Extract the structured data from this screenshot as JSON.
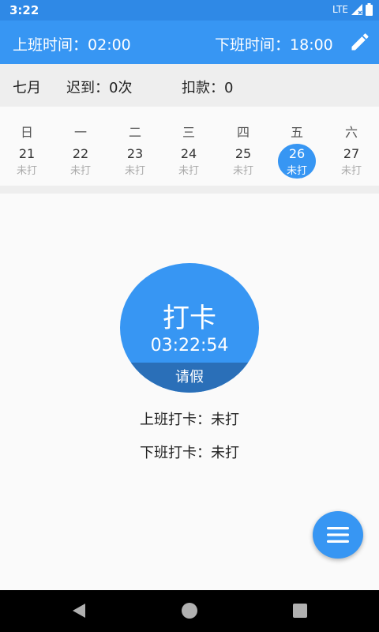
{
  "status_bar": {
    "time": "3:22",
    "network": "LTE"
  },
  "app_bar": {
    "start_label": "上班时间：",
    "start_time": "02:00",
    "end_label": "下班时间：",
    "end_time": "18:00",
    "edit_icon": "pencil-icon"
  },
  "summary": {
    "month": "七月",
    "late_label": "迟到：",
    "late_value": "0次",
    "deduct_label": "扣款：",
    "deduct_value": "0"
  },
  "week": {
    "days": [
      {
        "name": "日",
        "date": "21",
        "status": "未打",
        "selected": false
      },
      {
        "name": "一",
        "date": "22",
        "status": "未打",
        "selected": false
      },
      {
        "name": "二",
        "date": "23",
        "status": "未打",
        "selected": false
      },
      {
        "name": "三",
        "date": "24",
        "status": "未打",
        "selected": false
      },
      {
        "name": "四",
        "date": "25",
        "status": "未打",
        "selected": false
      },
      {
        "name": "五",
        "date": "26",
        "status": "未打",
        "selected": true
      },
      {
        "name": "六",
        "date": "27",
        "status": "未打",
        "selected": false
      }
    ]
  },
  "punch": {
    "label": "打卡",
    "time": "03:22:54",
    "leave_label": "请假"
  },
  "records": {
    "clock_in_label": "上班打卡：",
    "clock_in_value": "未打",
    "clock_out_label": "下班打卡：",
    "clock_out_value": "未打"
  },
  "fab": {
    "icon": "menu-icon"
  },
  "colors": {
    "primary": "#3796f3",
    "status_bar": "#2f89e6",
    "leave_bar": "#2a6fb8",
    "panel_gray": "#eeeeee"
  }
}
